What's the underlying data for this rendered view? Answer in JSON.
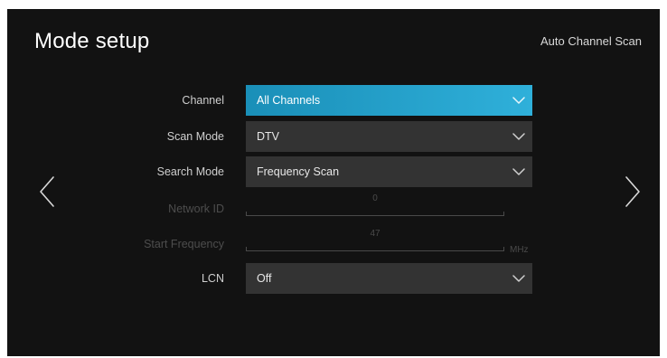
{
  "header": {
    "title": "Mode setup",
    "subtitle": "Auto Channel Scan"
  },
  "nav": {
    "prev_icon": "chevron-left-icon",
    "next_icon": "chevron-right-icon"
  },
  "settings": {
    "channel": {
      "label": "Channel",
      "value": "All Channels"
    },
    "scan_mode": {
      "label": "Scan Mode",
      "value": "DTV"
    },
    "search_mode": {
      "label": "Search Mode",
      "value": "Frequency Scan"
    },
    "network_id": {
      "label": "Network ID",
      "value": "0"
    },
    "start_frequency": {
      "label": "Start Frequency",
      "value": "47",
      "unit": "MHz"
    },
    "lcn": {
      "label": "LCN",
      "value": "Off"
    }
  },
  "colors": {
    "background": "#121212",
    "focus_start": "#1a8fb8",
    "focus_end": "#2fb0da",
    "field": "#333333",
    "disabled": "#4a4a4a"
  }
}
